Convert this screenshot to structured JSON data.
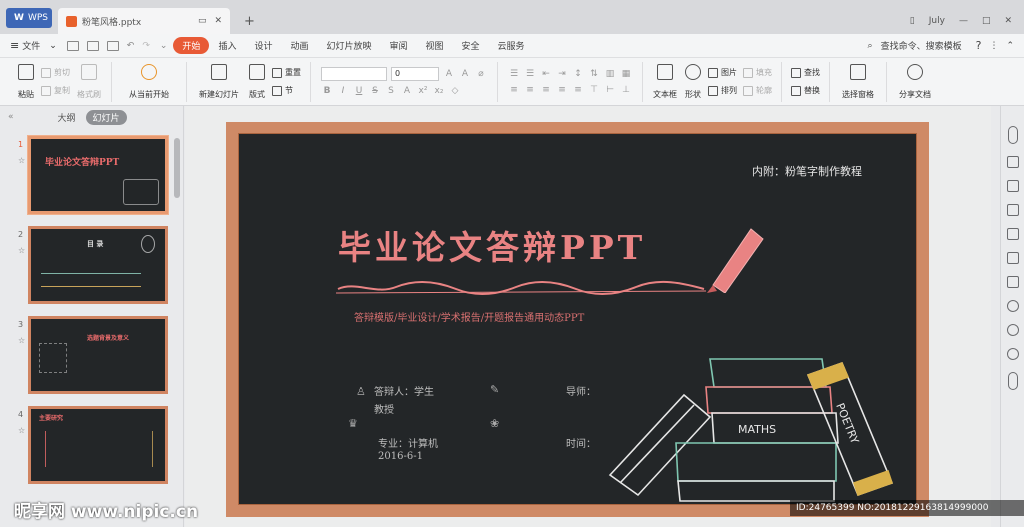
{
  "titlebar": {
    "app_tab": "WPS",
    "doc_tab": "粉笔风格.pptx",
    "new_tab": "+",
    "user": "July"
  },
  "menubar": {
    "file": "文件",
    "items": [
      "开始",
      "插入",
      "设计",
      "动画",
      "幻灯片放映",
      "审阅",
      "视图",
      "安全",
      "云服务"
    ],
    "active_index": 0,
    "search": "查找命令、搜索模板",
    "help": "?"
  },
  "ribbon": {
    "paste": "粘贴",
    "cut": "剪切",
    "copy": "复制",
    "format_painter": "格式刷",
    "play_from_current": "从当前开始",
    "new_slide": "新建幻灯片",
    "layout": "版式",
    "reset": "重置",
    "section": "节",
    "font_size": "0",
    "textbox": "文本框",
    "shape": "形状",
    "picture": "图片",
    "fill": "填充",
    "arrange": "排列",
    "outline": "轮廓",
    "find": "查找",
    "replace": "替换",
    "select_pane": "选择窗格",
    "share": "分享文档"
  },
  "sidebar": {
    "tab_outline": "大纲",
    "tab_slides": "幻灯片",
    "thumbs": [
      {
        "num": "1",
        "title": "毕业论文答辩PPT"
      },
      {
        "num": "2",
        "title": "目 录"
      },
      {
        "num": "3",
        "title": "选题背景及意义"
      },
      {
        "num": "4",
        "title": "主要研究"
      }
    ]
  },
  "slide": {
    "note": "内附：粉笔字制作教程",
    "title": "毕业论文答辩PPT",
    "desc": "答辩模版/毕业设计/学术报告/开题报告通用动态PPT",
    "presenter_label": "答辩人：学生",
    "advisor_label": "导师：",
    "advisor_name": "教授",
    "major": "专业：计算机",
    "date_label": "时间：",
    "date": "2016-6-1",
    "book1": "MATHS",
    "book2": "POETRY"
  },
  "watermark": {
    "site": "昵享网 www.nipic.cn",
    "id": "ID:24765399 NO:20181229163814999000"
  },
  "colors": {
    "accent": "#e85a36",
    "board": "#232628",
    "frame": "#cf8a66",
    "chalk_pink": "#e98383"
  }
}
